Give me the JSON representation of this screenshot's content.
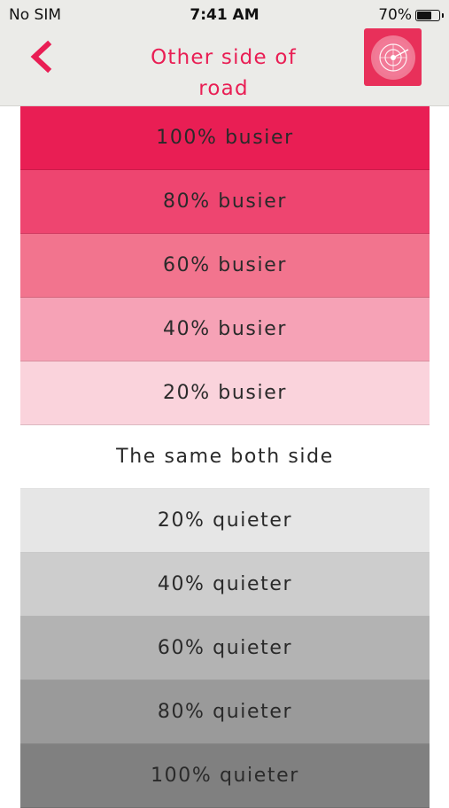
{
  "status_bar": {
    "carrier": "No SIM",
    "time": "7:41 AM",
    "battery_percent": "70%",
    "battery_level": 0.7
  },
  "nav": {
    "title_line1": "Other side of",
    "title_line2": "road",
    "accent_color": "#e91e54"
  },
  "options": [
    {
      "label": "100% busier",
      "color": "#e91e54"
    },
    {
      "label": "80% busier",
      "color": "#ee4570"
    },
    {
      "label": "60% busier",
      "color": "#f2748e"
    },
    {
      "label": "40% busier",
      "color": "#f6a2b6"
    },
    {
      "label": "20% busier",
      "color": "#fad3dc"
    },
    {
      "label": "The same both side",
      "color": "#ffffff"
    },
    {
      "label": "20% quieter",
      "color": "#e6e6e6"
    },
    {
      "label": "40% quieter",
      "color": "#cdcdcd"
    },
    {
      "label": "60% quieter",
      "color": "#b3b3b3"
    },
    {
      "label": "80% quieter",
      "color": "#9a9a9a"
    },
    {
      "label": "100% quieter",
      "color": "#808080"
    }
  ]
}
